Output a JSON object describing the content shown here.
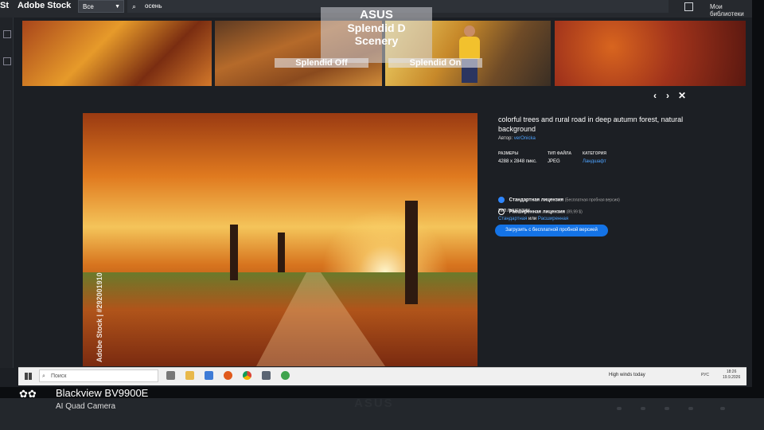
{
  "appbar": {
    "logo": "St",
    "brand": "Adobe Stock",
    "scope": "Все",
    "search_value": "осень",
    "libraries": "Мои библиотеки"
  },
  "osd": {
    "brand": "ASUS",
    "line1": "Splendid D",
    "line2": "Scenery",
    "option1": "Splendid Off",
    "option2": "Splendid On"
  },
  "nav": {
    "prev": "‹",
    "next": "›",
    "close": "✕"
  },
  "preview": {
    "watermark": "Adobe Stock | #292001910"
  },
  "details": {
    "title": "colorful trees and rural road in deep autumn forest, natural background",
    "author_label": "Автор:",
    "author": "verOnicka",
    "size_label": "РАЗМЕРЫ",
    "size_value": "4288 x 2848 пикс.",
    "filetype_label": "ТИП ФАЙЛА",
    "filetype_value": "JPEG",
    "category_label": "КАТЕГОРИЯ",
    "category_value": "Ландшафт",
    "license_label": "ТИП ЛИЦЕНЗИИ",
    "license_std": "Стандартная",
    "license_or": "или",
    "license_ext": "Расширенная",
    "radio_std": "Стандартная лицензия",
    "radio_std_note": "(Бесплатная пробная версия)",
    "radio_ext": "Расширенная лицензия",
    "radio_ext_note": "(89,99 $)",
    "cta": "Загрузить с бесплатной пробной версией"
  },
  "taskbar": {
    "search_placeholder": "Поиск",
    "weather": "High winds today",
    "lang": "РУС",
    "time": "18:26",
    "date": "19.9.2026"
  },
  "monitor": {
    "brand": "ASUS"
  },
  "camera": {
    "model": "Blackview BV9900E",
    "sub": "AI Quad Camera"
  },
  "colors": {
    "accent": "#1473e6",
    "link": "#4da3ff",
    "bg": "#1c1f24"
  }
}
